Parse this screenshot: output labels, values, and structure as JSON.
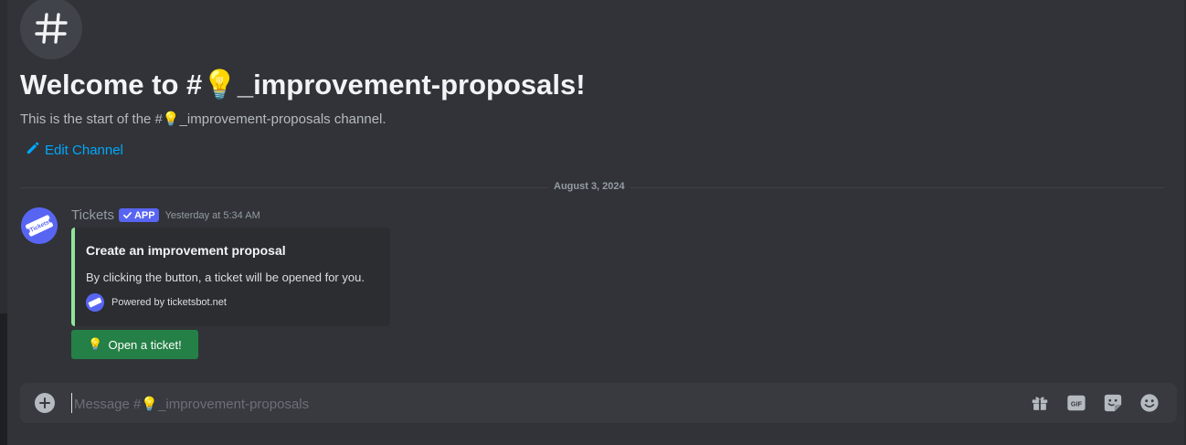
{
  "channel": {
    "hash_glyph": "#",
    "welcome_title": "Welcome to #💡_improvement-proposals!",
    "welcome_subtitle": "This is the start of the #💡_improvement-proposals channel.",
    "edit_label": "Edit Channel"
  },
  "divider": {
    "date": "August 3, 2024"
  },
  "message": {
    "author": "Tickets",
    "badge": "APP",
    "timestamp": "Yesterday at 5:34 AM",
    "avatar_text": "Tickets",
    "embed": {
      "title": "Create an improvement proposal",
      "description": "By clicking the button, a ticket will be opened for you.",
      "footer": "Powered by ticketsbot.net",
      "accent_color": "#8ee59b"
    },
    "button": {
      "emoji": "💡",
      "label": "Open a ticket!"
    }
  },
  "composer": {
    "placeholder": "Message #💡_improvement-proposals",
    "icons": [
      "add-icon",
      "gift-icon",
      "gif-icon",
      "sticker-icon",
      "emoji-icon"
    ],
    "gif_label": "GIF"
  },
  "colors": {
    "background": "#313338",
    "link": "#00a8fc",
    "brand": "#5865f2",
    "success": "#248046"
  }
}
